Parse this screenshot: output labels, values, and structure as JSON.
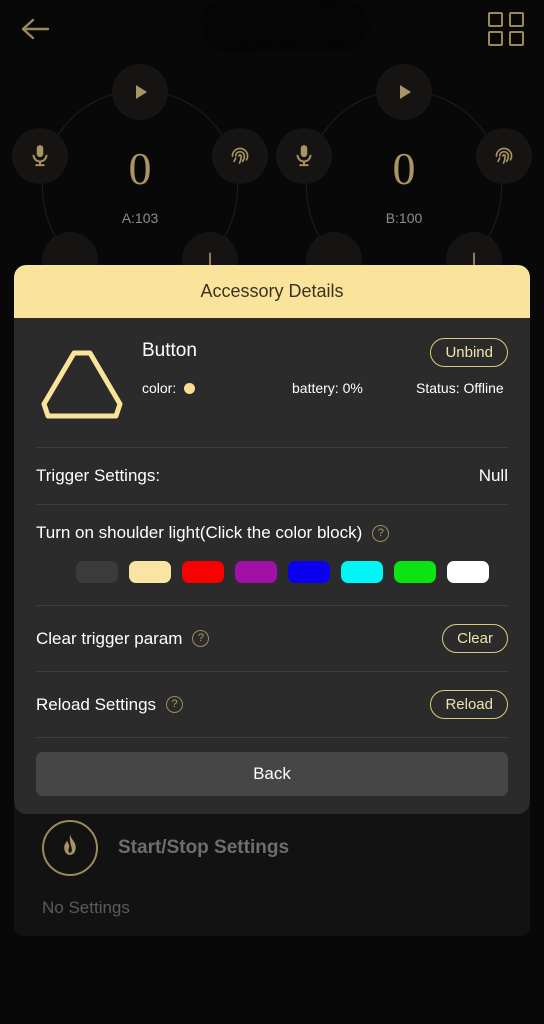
{
  "topbar": {
    "back_icon": "arrow-left-icon",
    "redacted_title": "",
    "grid_icon": "grid-2x2-icon"
  },
  "dials": [
    {
      "id": "a",
      "value": "0",
      "label": "A:103",
      "nodes": [
        "play-icon",
        "microphone-icon",
        "fingerprint-icon",
        "circle-icon",
        "plus-icon"
      ]
    },
    {
      "id": "b",
      "value": "0",
      "label": "B:100",
      "nodes": [
        "play-icon",
        "microphone-icon",
        "fingerprint-icon",
        "circle-icon",
        "plus-icon"
      ]
    }
  ],
  "dialog": {
    "title": "Accessory Details",
    "accessory": {
      "shape_icon": "rounded-triangle-icon",
      "name": "Button",
      "color_label": "color:",
      "color_value": "#fadf93",
      "battery": "battery: 0%",
      "status": "Status: Offline",
      "unbind_label": "Unbind"
    },
    "trigger": {
      "label": "Trigger Settings:",
      "value": "Null"
    },
    "shoulder_light": {
      "label": "Turn on shoulder light(Click the color block)",
      "help_icon": "help-circle-icon",
      "swatches": [
        {
          "name": "swatch-dark",
          "hex": "#3b3b3b"
        },
        {
          "name": "swatch-cream",
          "hex": "#fae4a3"
        },
        {
          "name": "swatch-red",
          "hex": "#fb0000"
        },
        {
          "name": "swatch-magenta",
          "hex": "#a210a5"
        },
        {
          "name": "swatch-blue",
          "hex": "#0b00f0"
        },
        {
          "name": "swatch-cyan",
          "hex": "#00f5f5"
        },
        {
          "name": "swatch-green",
          "hex": "#0ce312"
        },
        {
          "name": "swatch-white",
          "hex": "#ffffff"
        }
      ]
    },
    "clear_trigger": {
      "label": "Clear trigger param",
      "help_icon": "help-circle-icon",
      "button": "Clear"
    },
    "reload_settings": {
      "label": "Reload Settings",
      "help_icon": "help-circle-icon",
      "button": "Reload"
    },
    "back_button": "Back"
  },
  "startstop": {
    "icon": "flame-icon",
    "title": "Start/Stop Settings",
    "empty_text": "No Settings"
  },
  "colors": {
    "accent": "#fae49c",
    "gold": "#a99463",
    "panel": "#2b2b2b",
    "background": "#080808"
  }
}
